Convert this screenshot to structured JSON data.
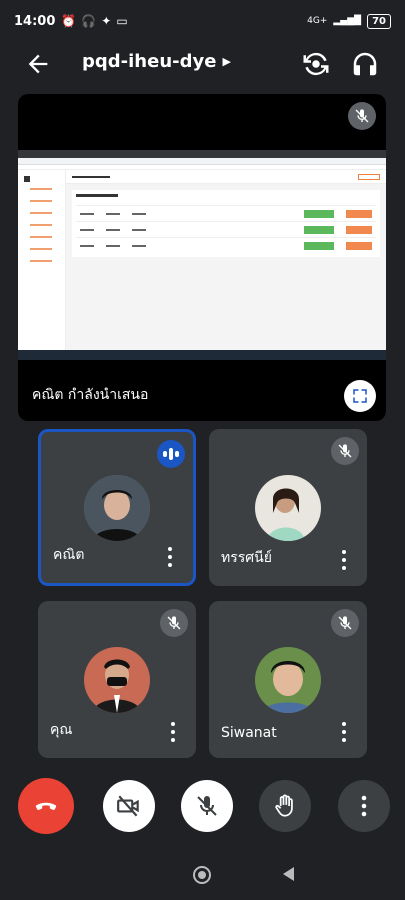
{
  "status_bar": {
    "time": "14:00",
    "network": "4G+",
    "battery": "70"
  },
  "header": {
    "meeting_code": "pqd-iheu-dye"
  },
  "presentation": {
    "presenter_label": "คณิต กำลังนำเสนอ"
  },
  "participants": [
    {
      "name": "คณิต",
      "state": "speaking"
    },
    {
      "name": "ทรรศนีย์",
      "state": "muted"
    },
    {
      "name": "คุณ",
      "state": "muted"
    },
    {
      "name": "Siwanat",
      "state": "muted"
    }
  ],
  "colors": {
    "background": "#202124",
    "tile": "#3c4043",
    "active_border": "#1a56c4",
    "end_call": "#ea4335"
  }
}
